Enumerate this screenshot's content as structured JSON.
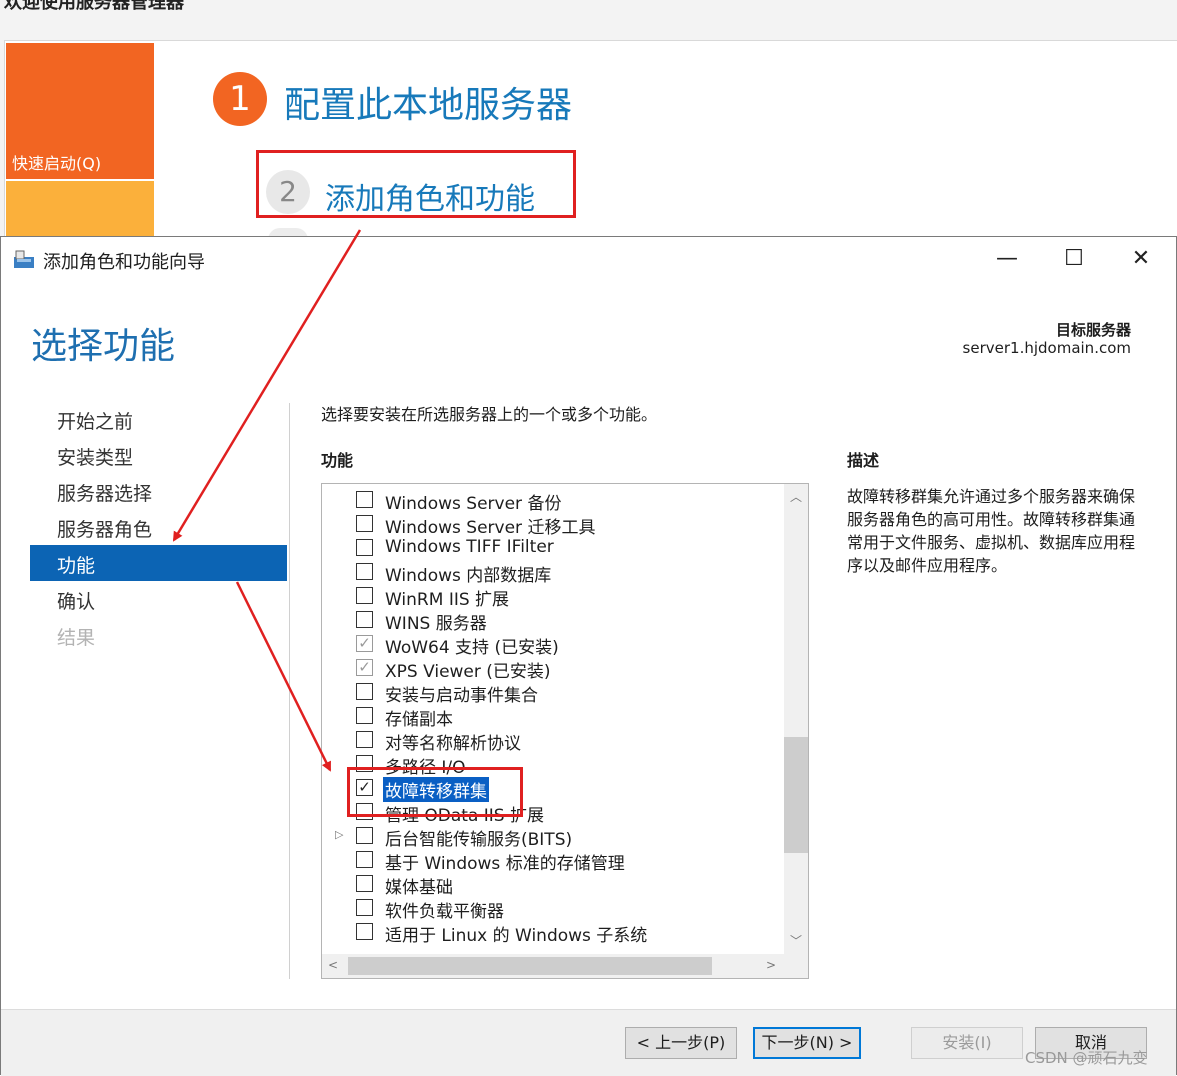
{
  "server_manager": {
    "title": "欢迎使用服务器管理器",
    "quick_start": "快速启动(Q)",
    "step1_number": "1",
    "step1_text": "配置此本地服务器",
    "step2_number": "2",
    "step2_text": "添加角色和功能"
  },
  "wizard": {
    "window_title": "添加角色和功能向导",
    "controls": {
      "minimize": "—",
      "maximize": "☐",
      "close": "✕"
    },
    "page_title": "选择功能",
    "destination_label": "目标服务器",
    "destination_server": "server1.hjdomain.com",
    "nav": [
      "开始之前",
      "安装类型",
      "服务器选择",
      "服务器角色",
      "功能",
      "确认",
      "结果"
    ],
    "instruction": "选择要安装在所选服务器上的一个或多个功能。",
    "features_header": "功能",
    "description_header": "描述",
    "description_text": "故障转移群集允许通过多个服务器来确保服务器角色的高可用性。故障转移群集通常用于文件服务、虚拟机、数据库应用程序以及邮件应用程序。",
    "features": [
      {
        "label": "Windows Server 备份",
        "checked": false
      },
      {
        "label": "Windows Server 迁移工具",
        "checked": false
      },
      {
        "label": "Windows TIFF IFilter",
        "checked": false
      },
      {
        "label": "Windows 内部数据库",
        "checked": false
      },
      {
        "label": "WinRM IIS 扩展",
        "checked": false
      },
      {
        "label": "WINS 服务器",
        "checked": false
      },
      {
        "label": "WoW64 支持 (已安装)",
        "checked": true,
        "installed": true
      },
      {
        "label": "XPS Viewer (已安装)",
        "checked": true,
        "installed": true
      },
      {
        "label": "安装与启动事件集合",
        "checked": false
      },
      {
        "label": "存储副本",
        "checked": false
      },
      {
        "label": "对等名称解析协议",
        "checked": false
      },
      {
        "label": "多路径 I/O",
        "checked": false
      },
      {
        "label": "故障转移群集",
        "checked": true,
        "selected": true
      },
      {
        "label": "管理 OData IIS 扩展",
        "checked": false
      },
      {
        "label": "后台智能传输服务(BITS)",
        "checked": false,
        "expandable": true
      },
      {
        "label": "基于 Windows 标准的存储管理",
        "checked": false
      },
      {
        "label": "媒体基础",
        "checked": false
      },
      {
        "label": "软件负载平衡器",
        "checked": false
      },
      {
        "label": "适用于 Linux 的 Windows 子系统",
        "checked": false
      }
    ],
    "buttons": {
      "previous": "< 上一步(P)",
      "next": "下一步(N) >",
      "install": "安装(I)",
      "cancel": "取消"
    }
  },
  "watermark": "CSDN @顽石九变",
  "colors": {
    "accent": "#0c64b4",
    "orange": "#f26522",
    "highlight_red": "#e02020"
  }
}
